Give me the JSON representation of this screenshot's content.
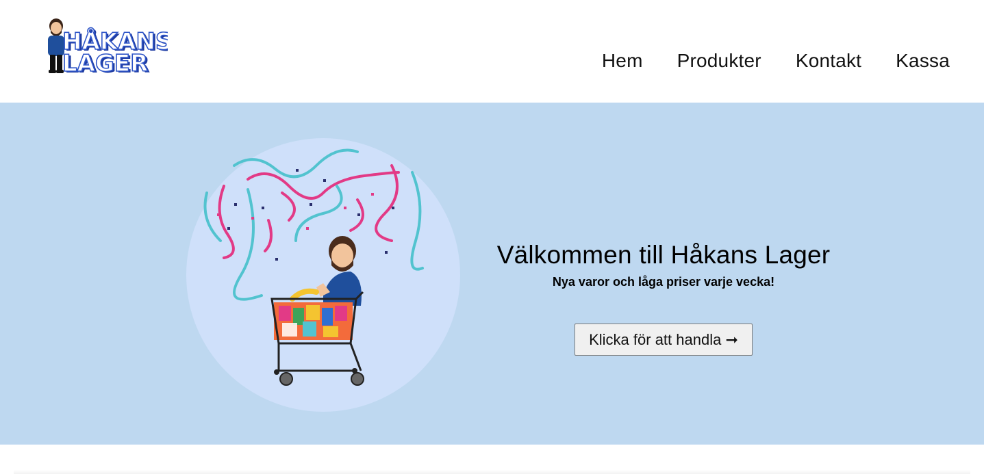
{
  "header": {
    "logo": {
      "line1": "HÅKANS",
      "line2": "LAGER",
      "colors": {
        "text": "#ffffff",
        "outline": "#2f56c8",
        "shadow": "#1d3aa0"
      }
    },
    "nav": [
      {
        "label": "Hem"
      },
      {
        "label": "Produkter"
      },
      {
        "label": "Kontakt"
      },
      {
        "label": "Kassa"
      }
    ]
  },
  "hero": {
    "title": "Välkommen till Håkans Lager",
    "subtitle": "Nya varor och låga priser varje vecka!",
    "cta_label": "Klicka för att handla ➞",
    "illustration": {
      "icon": "avatar-in-shopping-cart-with-confetti",
      "colors": {
        "circle": "#cfe0fa",
        "confetti_pink": "#e23a86",
        "confetti_teal": "#52c3cf",
        "confetti_navy": "#2a2f6e",
        "jacket": "#1f4f9c"
      }
    }
  },
  "colors": {
    "hero_background": "#bed8f0",
    "page_background": "#ffffff",
    "button_background": "#f0f0f0",
    "button_border": "#7a7a7a"
  }
}
